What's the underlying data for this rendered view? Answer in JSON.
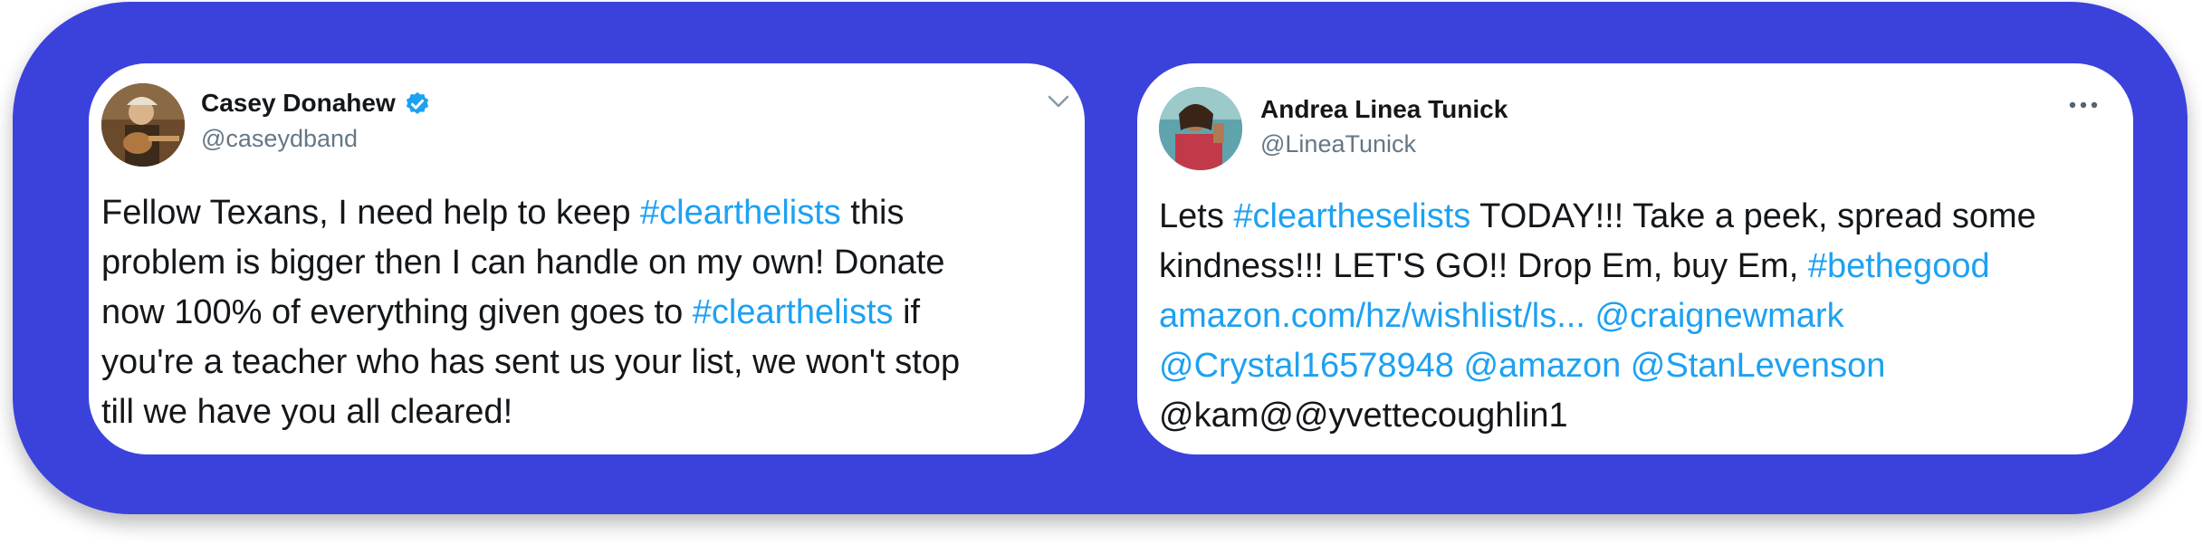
{
  "colors": {
    "frame": "#3b42dc",
    "link": "#1da1f2",
    "verified": "#1da1f2"
  },
  "tweets": [
    {
      "name": "Casey Donahew",
      "handle": "@caseydband",
      "verified_icon": "verified-badge-icon",
      "menu_icon": "chevron-down-icon",
      "lines": [
        [
          {
            "t": "Fellow Texans, I need help to keep "
          },
          {
            "t": "#clearthelists",
            "link": true
          },
          {
            "t": "  this"
          }
        ],
        [
          {
            "t": "problem is bigger then I can handle on my own! Donate"
          }
        ],
        [
          {
            "t": "now 100% of everything given goes to "
          },
          {
            "t": "#clearthelists",
            "link": true
          },
          {
            "t": " if"
          }
        ],
        [
          {
            "t": "you're a teacher who has sent us your list, we won't stop"
          }
        ],
        [
          {
            "t": "till we have you all cleared!"
          }
        ]
      ]
    },
    {
      "name": "Andrea Linea Tunick",
      "handle": "@LineaTunick",
      "menu_icon": "more-horizontal-icon",
      "lines": [
        [
          {
            "t": "Lets "
          },
          {
            "t": "#cleartheselists",
            "link": true
          },
          {
            "t": " TODAY!!! Take a peek, spread some"
          }
        ],
        [
          {
            "t": "kindness!!! LET'S GO!! Drop Em, buy Em, "
          },
          {
            "t": "#bethegood",
            "link": true
          }
        ],
        [
          {
            "t": "amazon.com/hz/wishlist/ls...",
            "link": true
          },
          {
            "t": " "
          },
          {
            "t": "@craignewmark",
            "link": true
          }
        ],
        [
          {
            "t": "@Crystal16578948",
            "link": true
          },
          {
            "t": " "
          },
          {
            "t": "@amazon",
            "link": true
          },
          {
            "t": " "
          },
          {
            "t": "@StanLevenson",
            "link": true
          }
        ],
        [
          {
            "t": "@kam@@yvettecoughlin1"
          }
        ]
      ]
    }
  ]
}
